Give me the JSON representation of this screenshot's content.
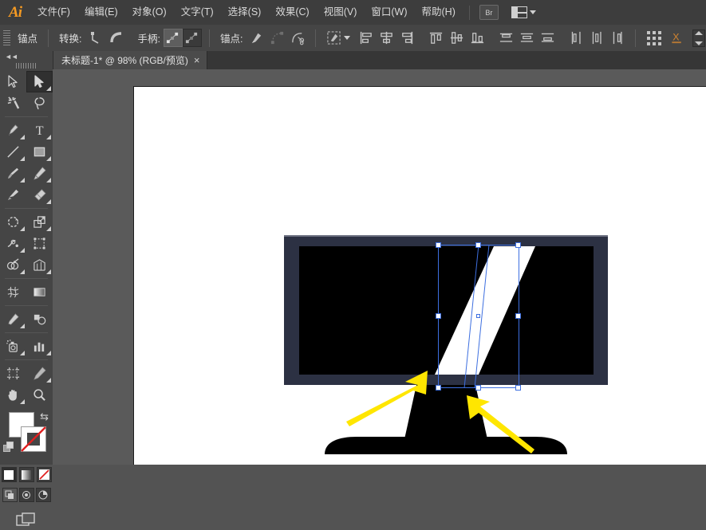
{
  "app": {
    "name": "Adobe Illustrator",
    "logo_text": "Ai"
  },
  "menubar": {
    "items": [
      {
        "label": "文件(F)",
        "name": "menu-file"
      },
      {
        "label": "编辑(E)",
        "name": "menu-edit"
      },
      {
        "label": "对象(O)",
        "name": "menu-object"
      },
      {
        "label": "文字(T)",
        "name": "menu-type"
      },
      {
        "label": "选择(S)",
        "name": "menu-select"
      },
      {
        "label": "效果(C)",
        "name": "menu-effect"
      },
      {
        "label": "视图(V)",
        "name": "menu-view"
      },
      {
        "label": "窗口(W)",
        "name": "menu-window"
      },
      {
        "label": "帮助(H)",
        "name": "menu-help"
      }
    ],
    "bridge_label": "Br",
    "workspace_icon": "workspace-switcher-icon"
  },
  "controlbar": {
    "title": "锚点",
    "convert_label": "转换:",
    "handles_label": "手柄:",
    "anchor_label": "锚点:",
    "icons": [
      "convert-to-corner-icon",
      "convert-to-smooth-icon",
      "show-handles-icon",
      "hide-handles-icon",
      "remove-anchor-icon",
      "connect-anchor-icon",
      "cut-path-icon",
      "isolate-selected-object-icon",
      "align-left-icon",
      "align-horizontal-center-icon",
      "align-right-icon",
      "align-top-icon",
      "align-vertical-center-icon",
      "align-bottom-icon",
      "distribute-top-icon",
      "distribute-vertical-center-icon",
      "distribute-bottom-icon",
      "distribute-left-icon",
      "distribute-horizontal-center-icon",
      "distribute-right-icon",
      "transform-panel-icon",
      "anchor-spacing-icon"
    ],
    "stepper_name": "anchor-spacing-stepper"
  },
  "tabbar": {
    "tab_title": "未标题-1* @ 98% (RGB/预览)",
    "close_glyph": "×"
  },
  "tools": {
    "collapse_glyph": "◄◄",
    "items": [
      {
        "name": "selection-tool",
        "label": "选择工具",
        "selected": false,
        "flyout": false
      },
      {
        "name": "direct-selection-tool",
        "label": "直接选择工具",
        "selected": true,
        "flyout": true
      },
      {
        "name": "magic-wand-tool",
        "label": "魔棒工具",
        "selected": false,
        "flyout": false
      },
      {
        "name": "lasso-tool",
        "label": "套索工具",
        "selected": false,
        "flyout": false
      },
      {
        "name": "pen-tool",
        "label": "钢笔工具",
        "selected": false,
        "flyout": true
      },
      {
        "name": "type-tool",
        "label": "文字工具",
        "selected": false,
        "flyout": true
      },
      {
        "name": "line-segment-tool",
        "label": "直线段工具",
        "selected": false,
        "flyout": true
      },
      {
        "name": "rectangle-tool",
        "label": "矩形工具",
        "selected": false,
        "flyout": true
      },
      {
        "name": "paintbrush-tool",
        "label": "画笔工具",
        "selected": false,
        "flyout": true
      },
      {
        "name": "pencil-tool",
        "label": "铅笔工具",
        "selected": false,
        "flyout": true
      },
      {
        "name": "blob-brush-tool",
        "label": "斑点画笔工具",
        "selected": false,
        "flyout": false
      },
      {
        "name": "eraser-tool",
        "label": "橡皮擦工具",
        "selected": false,
        "flyout": true
      },
      {
        "name": "rotate-tool",
        "label": "旋转工具",
        "selected": false,
        "flyout": true
      },
      {
        "name": "scale-tool",
        "label": "比例缩放工具",
        "selected": false,
        "flyout": true
      },
      {
        "name": "width-tool",
        "label": "宽度工具",
        "selected": false,
        "flyout": true
      },
      {
        "name": "free-transform-tool",
        "label": "自由变换工具",
        "selected": false,
        "flyout": false
      },
      {
        "name": "shape-builder-tool",
        "label": "形状生成器工具",
        "selected": false,
        "flyout": true
      },
      {
        "name": "perspective-grid-tool",
        "label": "透视网格工具",
        "selected": false,
        "flyout": true
      },
      {
        "name": "mesh-tool",
        "label": "网格工具",
        "selected": false,
        "flyout": false
      },
      {
        "name": "gradient-tool",
        "label": "渐变工具",
        "selected": false,
        "flyout": false
      },
      {
        "name": "eyedropper-tool",
        "label": "吸管工具",
        "selected": false,
        "flyout": true
      },
      {
        "name": "blend-tool",
        "label": "混合工具",
        "selected": false,
        "flyout": false
      },
      {
        "name": "symbol-sprayer-tool",
        "label": "符号喷枪工具",
        "selected": false,
        "flyout": true
      },
      {
        "name": "column-graph-tool",
        "label": "柱形图工具",
        "selected": false,
        "flyout": true
      },
      {
        "name": "artboard-tool",
        "label": "画板工具",
        "selected": false,
        "flyout": false
      },
      {
        "name": "slice-tool",
        "label": "切片工具",
        "selected": false,
        "flyout": true
      },
      {
        "name": "hand-tool",
        "label": "抓手工具",
        "selected": false,
        "flyout": true
      },
      {
        "name": "zoom-tool",
        "label": "缩放工具",
        "selected": false,
        "flyout": false
      }
    ],
    "fill_color": "#ffffff",
    "stroke_color": "none",
    "swap_glyph": "⇆",
    "paint_modes": [
      {
        "name": "color-button",
        "label": "颜色",
        "selected": true
      },
      {
        "name": "gradient-button",
        "label": "渐变",
        "selected": false
      },
      {
        "name": "none-button",
        "label": "无",
        "selected": false
      }
    ],
    "draw_modes": [
      {
        "name": "draw-normal-button",
        "label": "正常绘图",
        "selected": true
      },
      {
        "name": "draw-behind-button",
        "label": "背面绘图",
        "selected": false
      },
      {
        "name": "draw-inside-button",
        "label": "内部绘图",
        "selected": false
      }
    ],
    "screen_mode": {
      "name": "change-screen-mode-button",
      "label": "更改屏幕模式"
    }
  },
  "canvas": {
    "zoom": "98%",
    "color_mode": "RGB",
    "view_mode": "预览",
    "background_color": "#5a5a5a",
    "artboard_color": "#ffffff",
    "artwork": {
      "name": "显示器插画",
      "bezel_color": "#2c3143",
      "screen_color": "#000000",
      "highlight_color": "#ffffff",
      "stand_color": "#000000"
    },
    "selection": {
      "name": "选中的白色平行四边形",
      "bounding_box_color": "#3d6fe0",
      "handle_count": 8,
      "has_center_point": true
    },
    "annotations": [
      {
        "name": "annotation-arrow-left",
        "color": "#ffe600",
        "direction": "up-right"
      },
      {
        "name": "annotation-arrow-right",
        "color": "#ffe600",
        "direction": "up-left"
      }
    ]
  }
}
